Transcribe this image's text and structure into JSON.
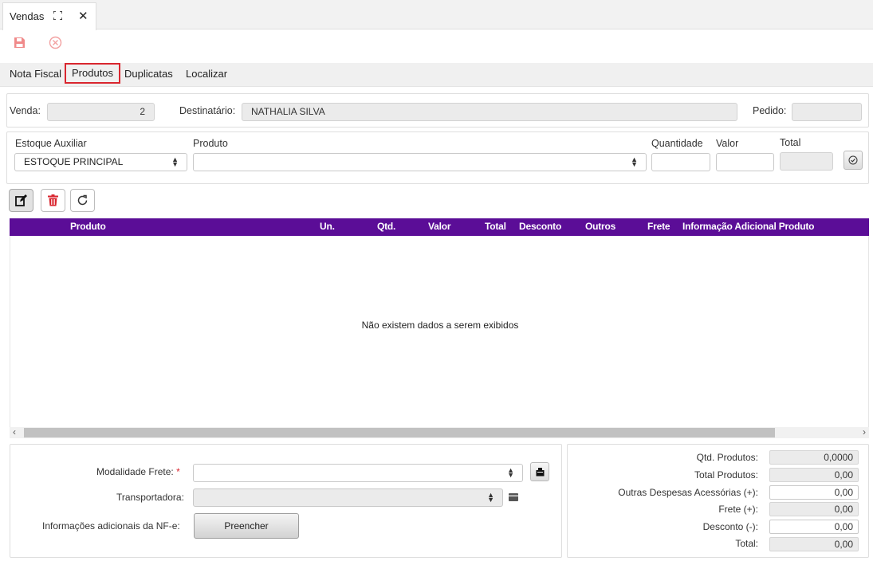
{
  "tab": {
    "title": "Vendas"
  },
  "menu": [
    "Nota Fiscal",
    "Produtos",
    "Duplicatas",
    "Localizar"
  ],
  "header": {
    "venda_label": "Venda:",
    "venda_value": "2",
    "destinatario_label": "Destinatário:",
    "destinatario_value": "NATHALIA SILVA",
    "pedido_label": "Pedido:",
    "pedido_value": ""
  },
  "product_entry": {
    "estoque_label": "Estoque Auxiliar",
    "estoque_value": "ESTOQUE PRINCIPAL",
    "produto_label": "Produto",
    "produto_value": "",
    "quantidade_label": "Quantidade",
    "valor_label": "Valor",
    "total_label": "Total"
  },
  "grid": {
    "columns": [
      "Produto",
      "Un.",
      "Qtd.",
      "Valor",
      "Total",
      "Desconto",
      "Outros",
      "Frete",
      "Informação Adicional Produto"
    ],
    "empty_message": "Não existem dados a serem exibidos",
    "header_color": "#5b0d97"
  },
  "shipping": {
    "modalidade_label": "Modalidade Frete:",
    "required_mark": "*",
    "modalidade_value": "",
    "transportadora_label": "Transportadora:",
    "transportadora_value": "",
    "info_label": "Informações adicionais da NF-e:",
    "fill_button": "Preencher"
  },
  "totals": [
    {
      "label": "Qtd. Produtos:",
      "value": "0,0000",
      "readonly": true
    },
    {
      "label": "Total Produtos:",
      "value": "0,00",
      "readonly": true
    },
    {
      "label": "Outras Despesas Acessórias (+):",
      "value": "0,00",
      "readonly": false
    },
    {
      "label": "Frete (+):",
      "value": "0,00",
      "readonly": true
    },
    {
      "label": "Desconto (-):",
      "value": "0,00",
      "readonly": false
    },
    {
      "label": "Total:",
      "value": "0,00",
      "readonly": true
    }
  ],
  "icons": {
    "save": "save-icon",
    "cancel": "cancel-icon",
    "edit": "edit-icon",
    "delete": "trash-icon",
    "refresh": "refresh-icon",
    "maximize": "maximize-icon",
    "close": "close-icon",
    "confirm": "check-circle-icon",
    "accent_red": "#d9262f",
    "save_color": "#f08a8a"
  }
}
